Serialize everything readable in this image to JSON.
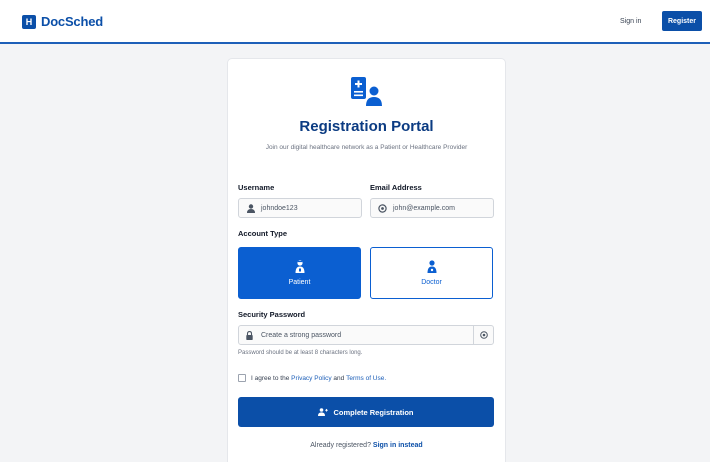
{
  "header": {
    "logo_letter": "H",
    "brand": "DocSched",
    "signin_label": "Sign in",
    "register_label": "Register"
  },
  "form": {
    "title": "Registration Portal",
    "subtitle": "Join our digital healthcare network as a Patient or Healthcare Provider",
    "username_label": "Username",
    "username_placeholder": "johndoe123",
    "email_label": "Email Address",
    "email_placeholder": "john@example.com",
    "account_type_label": "Account Type",
    "account_types": [
      {
        "label": "Patient",
        "selected": true,
        "icon": "user-injured-icon"
      },
      {
        "label": "Doctor",
        "selected": false,
        "icon": "user-doctor-icon"
      }
    ],
    "password_label": "Security Password",
    "password_placeholder": "Create a strong password",
    "password_hint": "Password should be at least 8 characters long.",
    "terms_prefix": "I agree to the",
    "privacy_link": "Privacy Policy",
    "terms_and": "and",
    "terms_link": "Terms of Use.",
    "submit_label": "Complete Registration",
    "footer_prefix": "Already registered?",
    "footer_link": "Sign in instead"
  },
  "colors": {
    "primary": "#0b4fa8",
    "selected": "#0b5fd1",
    "title": "#0b3b82",
    "page_bg": "#f3f4f6"
  }
}
